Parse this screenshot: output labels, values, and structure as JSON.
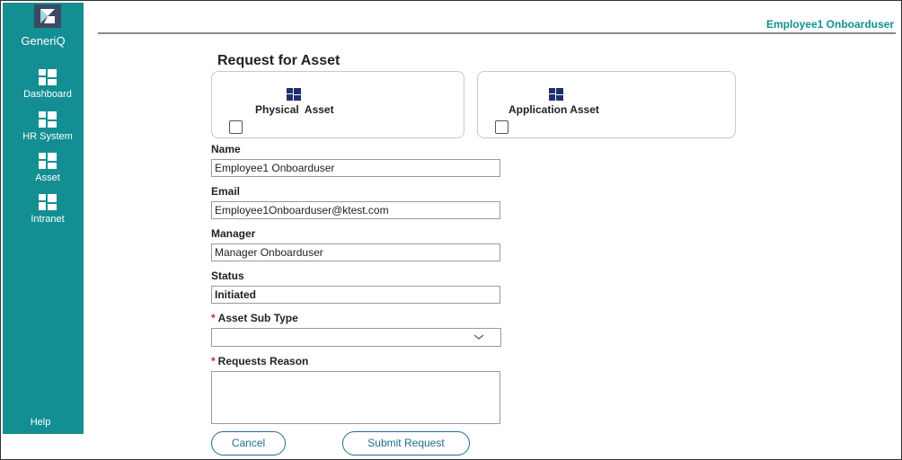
{
  "app": {
    "name": "GeneriQ"
  },
  "sidebar": {
    "items": [
      {
        "label": "Dashboard",
        "icon": "grid-icon"
      },
      {
        "label": "HR System",
        "icon": "grid-icon"
      },
      {
        "label": "Asset",
        "icon": "grid-icon"
      },
      {
        "label": "Intranet",
        "icon": "grid-icon"
      }
    ],
    "help_label": "Help"
  },
  "header": {
    "user_name": "Employee1 Onboarduser"
  },
  "form": {
    "title": "Request for Asset",
    "asset_types": [
      {
        "label": "Physical  Asset",
        "checked": false
      },
      {
        "label": "Application Asset",
        "checked": false
      }
    ],
    "name": {
      "label": "Name",
      "value": "Employee1 Onboarduser"
    },
    "email": {
      "label": "Email",
      "value": "Employee1Onboarduser@ktest.com"
    },
    "manager": {
      "label": "Manager",
      "value": "Manager Onboarduser"
    },
    "status": {
      "label": "Status",
      "value": "Initiated"
    },
    "asset_sub_type": {
      "label": "Asset Sub Type",
      "required_mark": "*",
      "value": ""
    },
    "requests_reason": {
      "label": "Requests Reason",
      "required_mark": "*",
      "value": ""
    },
    "cancel_label": "Cancel",
    "submit_label": "Submit Request"
  },
  "colors": {
    "sidebar_bg": "#138f93",
    "accent_text": "#138f93",
    "button_border": "#1b6e8f",
    "icon_navy": "#1f2f6e",
    "required": "#c62828"
  }
}
